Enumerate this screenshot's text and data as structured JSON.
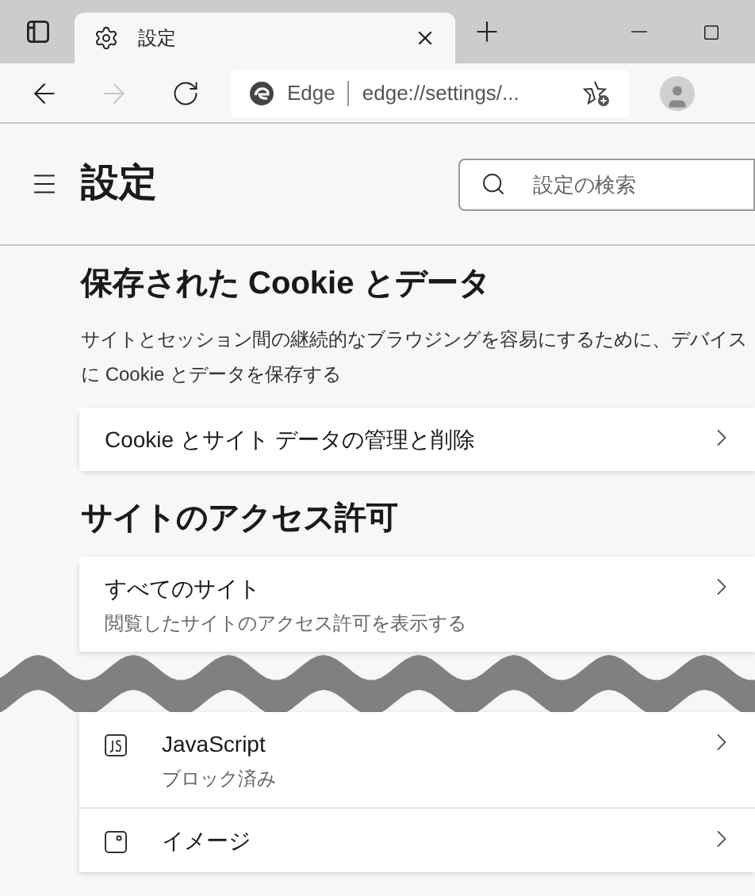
{
  "window": {
    "tab_title": "設定"
  },
  "toolbar": {
    "back": {
      "disabled": false
    },
    "forward": {
      "disabled": true
    },
    "site_label": "Edge",
    "url": "edge://settings/..."
  },
  "page": {
    "title": "設定",
    "search": {
      "placeholder": "設定の検索"
    }
  },
  "sections": [
    {
      "heading": "保存された Cookie とデータ",
      "description": "サイトとセッション間の継続的なブラウジングを容易にするために、デバイスに Cookie とデータを保存する",
      "items": [
        {
          "kind": "plain",
          "label": "Cookie とサイト データの管理と削除"
        }
      ]
    },
    {
      "heading": "サイトのアクセス許可",
      "items": [
        {
          "kind": "plain",
          "label": "すべてのサイト",
          "sublabel": "閲覧したサイトのアクセス許可を表示する"
        },
        {
          "kind": "wave"
        },
        {
          "kind": "script",
          "label": "JavaScript",
          "sublabel": "ブロック済み"
        },
        {
          "kind": "image",
          "label": "イメージ"
        }
      ]
    }
  ]
}
